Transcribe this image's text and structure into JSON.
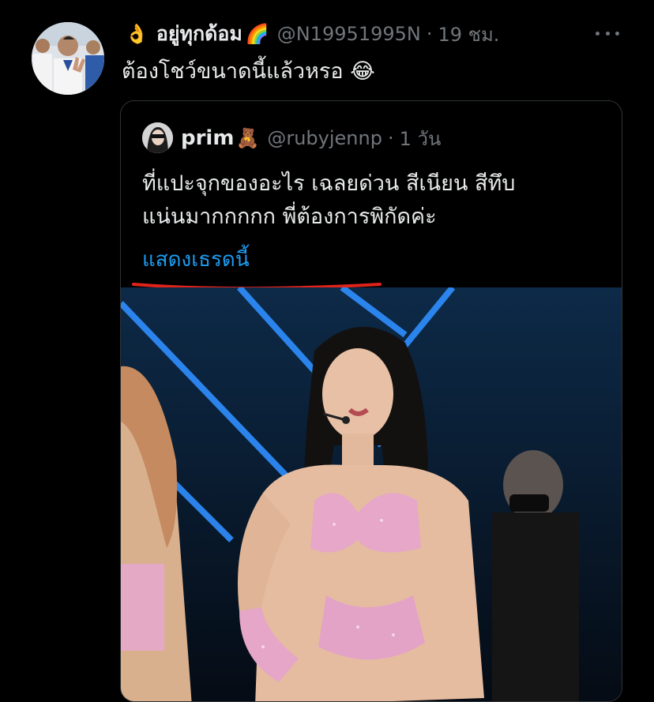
{
  "tweet": {
    "display_name": "อยู่ทุกด้อม",
    "hand_emoji": "👌",
    "rainbow_emoji": "🌈",
    "handle": "@N19951995N",
    "separator": "·",
    "time": "19 ชม.",
    "text": "ต้องโชว์ขนาดนี้แล้วหรอ 😂"
  },
  "quoted": {
    "display_name": "prim",
    "bear_emoji": "🧸",
    "handle": "@rubyjennp",
    "separator": "·",
    "time": "1 วัน",
    "text_line1": "ที่แปะจุกของอะไร เฉลยด่วน สีเนียน สีทึบ",
    "text_line2": "แน่นมากกกกก พี่ต้องการพิกัดค่ะ",
    "show_thread": "แสดงเธรดนี้"
  },
  "colors": {
    "background": "#000000",
    "primary_text": "#e7e9ea",
    "secondary_text": "#71767b",
    "link": "#1d9bf0",
    "border": "#2f3336",
    "annotation_underline": "#e0231b"
  }
}
